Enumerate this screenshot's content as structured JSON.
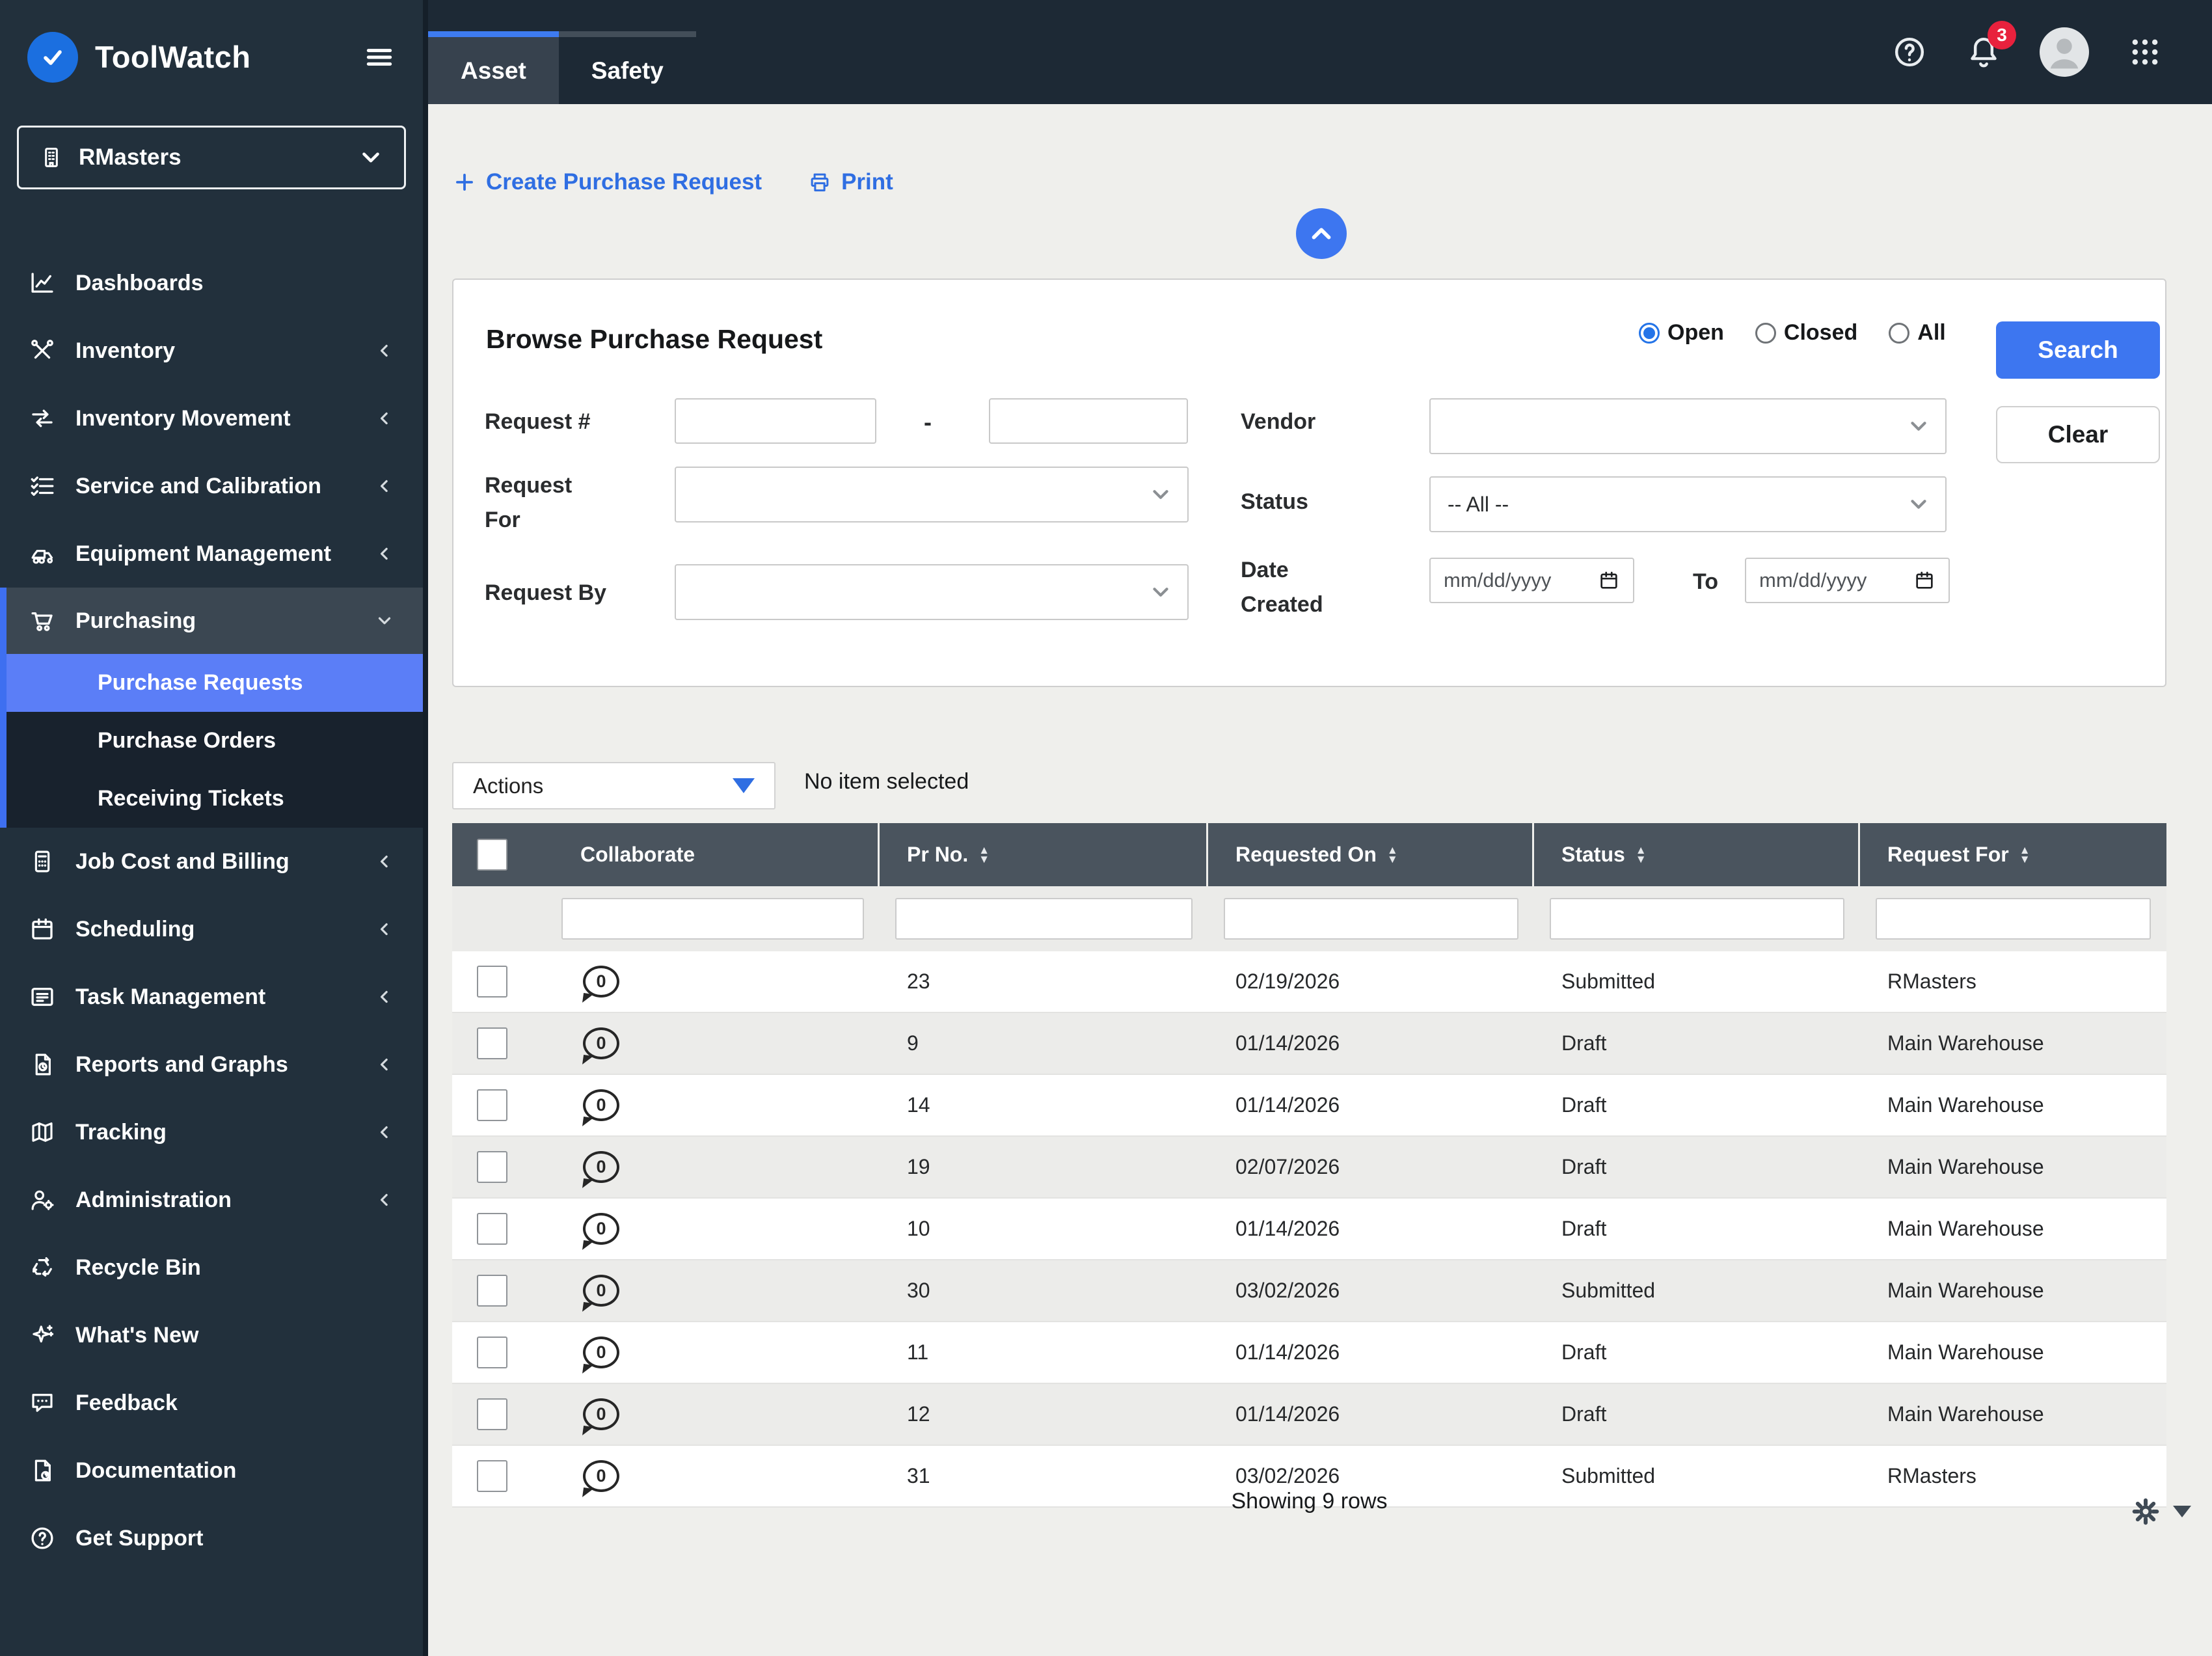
{
  "brand": {
    "name": "ToolWatch",
    "entity": "RMasters"
  },
  "topbar": {
    "tabs": [
      {
        "label": "Asset"
      },
      {
        "label": "Safety"
      }
    ],
    "notification_count": "3"
  },
  "sidebar": {
    "items_top": [
      {
        "label": "Dashboards",
        "icon": "chart",
        "chevron": ""
      },
      {
        "label": "Inventory",
        "icon": "tools",
        "chevron": "chevron-left"
      },
      {
        "label": "Inventory Movement",
        "icon": "swap",
        "chevron": "chevron-left"
      },
      {
        "label": "Service and Calibration",
        "icon": "checklist",
        "chevron": "chevron-left"
      },
      {
        "label": "Equipment Management",
        "icon": "loader",
        "chevron": "chevron-left"
      }
    ],
    "purchasing": {
      "label": "Purchasing",
      "icon": "cart"
    },
    "purchasing_children": [
      {
        "label": "Purchase Requests",
        "classes": [
          "sel"
        ]
      },
      {
        "label": "Purchase Orders"
      },
      {
        "label": "Receiving Tickets"
      }
    ],
    "items_bottom": [
      {
        "label": "Job Cost and Billing",
        "icon": "calc",
        "chevron": "chevron-left"
      },
      {
        "label": "Scheduling",
        "icon": "calendar",
        "chevron": "chevron-left"
      },
      {
        "label": "Task Management",
        "icon": "tasklist",
        "chevron": "chevron-left"
      },
      {
        "label": "Reports and Graphs",
        "icon": "report",
        "chevron": "chevron-left"
      },
      {
        "label": "Tracking",
        "icon": "map",
        "chevron": "chevron-left"
      },
      {
        "label": "Administration",
        "icon": "person-gear",
        "chevron": "chevron-left"
      },
      {
        "label": "Recycle Bin",
        "icon": "recycle",
        "chevron": ""
      },
      {
        "label": "What's New",
        "icon": "sparkle",
        "chevron": ""
      },
      {
        "label": "Feedback",
        "icon": "chat",
        "chevron": ""
      },
      {
        "label": "Documentation",
        "icon": "doc-help",
        "chevron": ""
      },
      {
        "label": "Get Support",
        "icon": "question",
        "chevron": ""
      }
    ]
  },
  "toolbar": {
    "create_label": "Create Purchase Request",
    "print_label": "Print"
  },
  "filter_panel": {
    "title": "Browse Purchase Request",
    "radios": {
      "open": "Open",
      "closed": "Closed",
      "all": "All"
    },
    "search_label": "Search",
    "clear_label": "Clear",
    "labels": {
      "request_no": "Request #",
      "request_for": "Request For",
      "request_by": "Request By",
      "vendor": "Vendor",
      "status": "Status",
      "date_created": "Date Created",
      "to": "To"
    },
    "range_separator": "-",
    "status_value": "-- All --",
    "date_placeholder": "mm/dd/yyyy"
  },
  "actions": {
    "label": "Actions",
    "no_selection": "No item selected"
  },
  "table": {
    "columns": [
      "Collaborate",
      "Pr No.",
      "Requested On",
      "Status",
      "Request For"
    ],
    "rows": [
      {
        "comments": "0",
        "pr_no": "23",
        "requested_on": "02/19/2026",
        "status": "Submitted",
        "request_for": "RMasters"
      },
      {
        "comments": "0",
        "pr_no": "9",
        "requested_on": "01/14/2026",
        "status": "Draft",
        "request_for": "Main Warehouse"
      },
      {
        "comments": "0",
        "pr_no": "14",
        "requested_on": "01/14/2026",
        "status": "Draft",
        "request_for": "Main Warehouse"
      },
      {
        "comments": "0",
        "pr_no": "19",
        "requested_on": "02/07/2026",
        "status": "Draft",
        "request_for": "Main Warehouse"
      },
      {
        "comments": "0",
        "pr_no": "10",
        "requested_on": "01/14/2026",
        "status": "Draft",
        "request_for": "Main Warehouse"
      },
      {
        "comments": "0",
        "pr_no": "30",
        "requested_on": "03/02/2026",
        "status": "Submitted",
        "request_for": "Main Warehouse"
      },
      {
        "comments": "0",
        "pr_no": "11",
        "requested_on": "01/14/2026",
        "status": "Draft",
        "request_for": "Main Warehouse"
      },
      {
        "comments": "0",
        "pr_no": "12",
        "requested_on": "01/14/2026",
        "status": "Draft",
        "request_for": "Main Warehouse"
      },
      {
        "comments": "0",
        "pr_no": "31",
        "requested_on": "03/02/2026",
        "status": "Submitted",
        "request_for": "RMasters"
      }
    ]
  },
  "footer": {
    "summary": "Showing 9 rows"
  },
  "colors": {
    "accent_blue": "#3d76f0",
    "selected_nav_blue": "#5b7ef7",
    "link_blue": "#2f6ee2",
    "sidebar_bg": "#22303c",
    "topbar_bg": "#1d2935",
    "table_header_bg": "#4a545e",
    "badge_red": "#e8213d",
    "page_bg": "#efefec"
  }
}
